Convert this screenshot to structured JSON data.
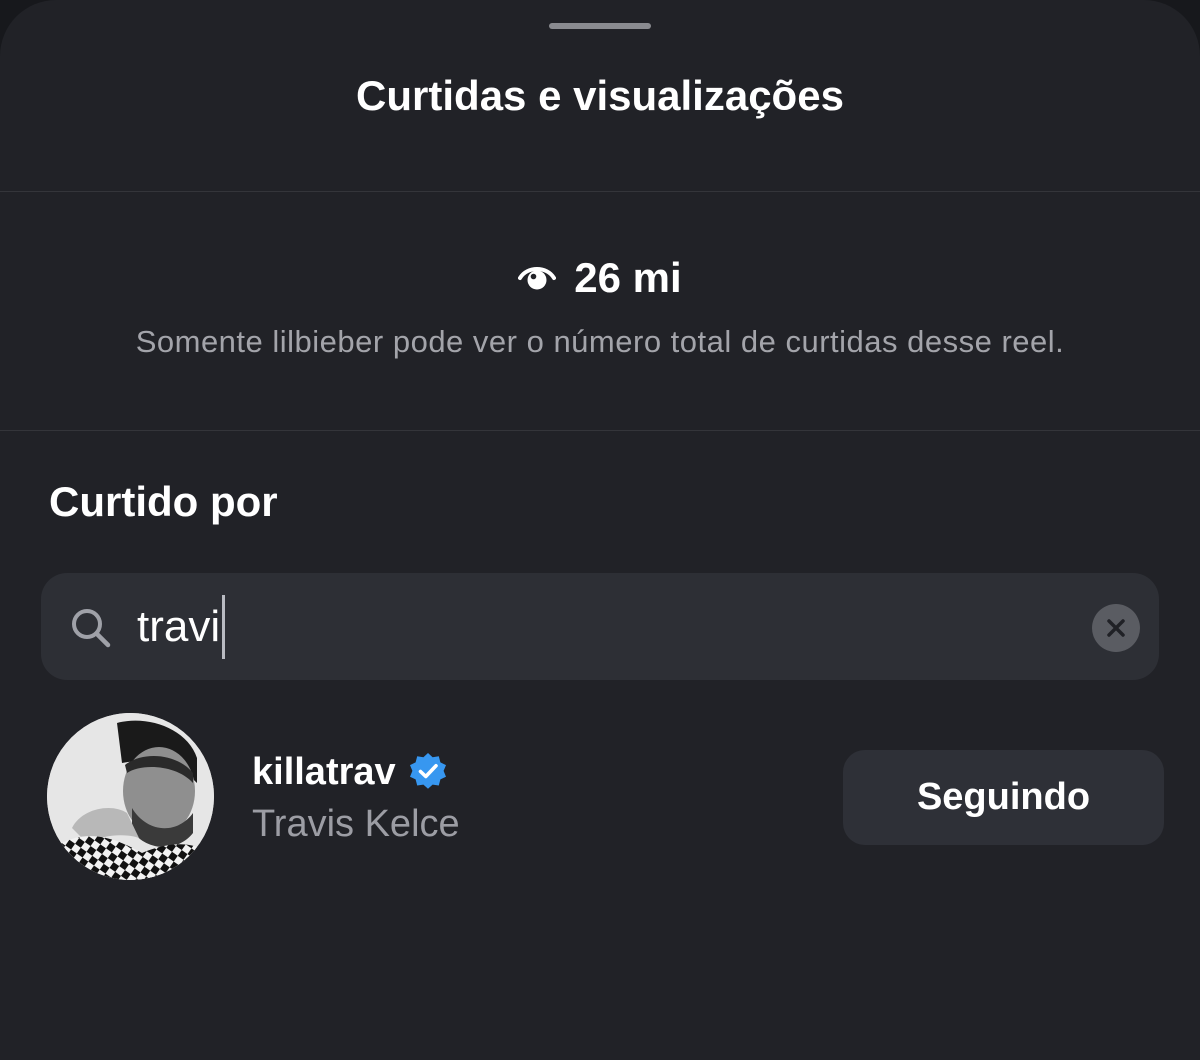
{
  "sheet": {
    "title": "Curtidas e visualizações"
  },
  "views": {
    "icon": "eye-icon",
    "count": "26 mi",
    "note": "Somente lilbieber pode ver o número total de curtidas desse reel."
  },
  "liked_by": {
    "title": "Curtido por",
    "search": {
      "icon": "search-icon",
      "value": "travi",
      "clear_icon": "clear-circle-icon"
    },
    "users": [
      {
        "username": "killatrav",
        "verified": true,
        "full_name": "Travis Kelce",
        "button_label": "Seguindo"
      }
    ]
  },
  "colors": {
    "sheet_background": "#212227",
    "search_background": "#2d2f35",
    "button_background": "#2e3037",
    "verified_badge": "#3797f0",
    "secondary_text": "#a3a4aa"
  }
}
